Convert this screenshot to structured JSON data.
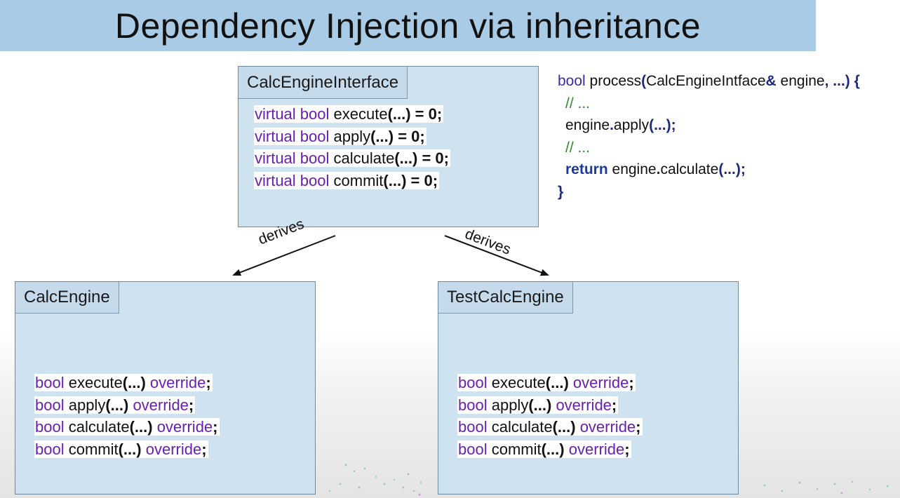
{
  "slide": {
    "title": "Dependency Injection via inheritance"
  },
  "interface_box": {
    "name": "CalcEngineInterface",
    "lines": [
      {
        "kw": "virtual bool",
        "name": "execute",
        "tail": "(...) = 0;"
      },
      {
        "kw": "virtual bool",
        "name": "apply",
        "tail": "(...) = 0;"
      },
      {
        "kw": "virtual bool",
        "name": "calculate",
        "tail": "(...) = 0;"
      },
      {
        "kw": "virtual bool",
        "name": "commit",
        "tail": "(...) = 0;"
      }
    ]
  },
  "calc_engine_box": {
    "name": "CalcEngine",
    "lines": [
      {
        "kw": "bool",
        "name": "execute",
        "args": "(...)",
        "ov": "override",
        "end": ";"
      },
      {
        "kw": "bool",
        "name": "apply",
        "args": "(...)",
        "ov": "override",
        "end": ";"
      },
      {
        "kw": "bool",
        "name": "calculate",
        "args": "(...)",
        "ov": "override",
        "end": ";"
      },
      {
        "kw": "bool",
        "name": "commit",
        "args": "(...)",
        "ov": "override",
        "end": ";"
      }
    ]
  },
  "test_calc_engine_box": {
    "name": "TestCalcEngine",
    "lines": [
      {
        "kw": "bool",
        "name": "execute",
        "args": "(...)",
        "ov": "override",
        "end": ";"
      },
      {
        "kw": "bool",
        "name": "apply",
        "args": "(...)",
        "ov": "override",
        "end": ";"
      },
      {
        "kw": "bool",
        "name": "calculate",
        "args": "(...)",
        "ov": "override",
        "end": ";"
      },
      {
        "kw": "bool",
        "name": "commit",
        "args": "(...)",
        "ov": "override",
        "end": ";"
      }
    ]
  },
  "arrows": {
    "left_label": "derives",
    "right_label": "derives"
  },
  "process_code": {
    "l1_kw": "bool",
    "l1_fn": " process",
    "l1_paren": "(",
    "l1_type": "CalcEngineIntface",
    "l1_amp": "&",
    "l1_param": " engine",
    "l1_rest": ", ...) {",
    "l2": "// ...",
    "l3_obj": "engine",
    "l3_dot": ".",
    "l3_fn": "apply",
    "l3_args": "(...);",
    "l4": "// ...",
    "l5_kw": "return",
    "l5_obj": " engine",
    "l5_dot": ".",
    "l5_fn": "calculate",
    "l5_args": "(...);",
    "l6": "}"
  },
  "colors": {
    "title_bar": "#a9cbe5",
    "box_fill": "#cfe2f0",
    "keyword_purple": "#6a1fb0",
    "comment_green": "#2a8a2a"
  }
}
